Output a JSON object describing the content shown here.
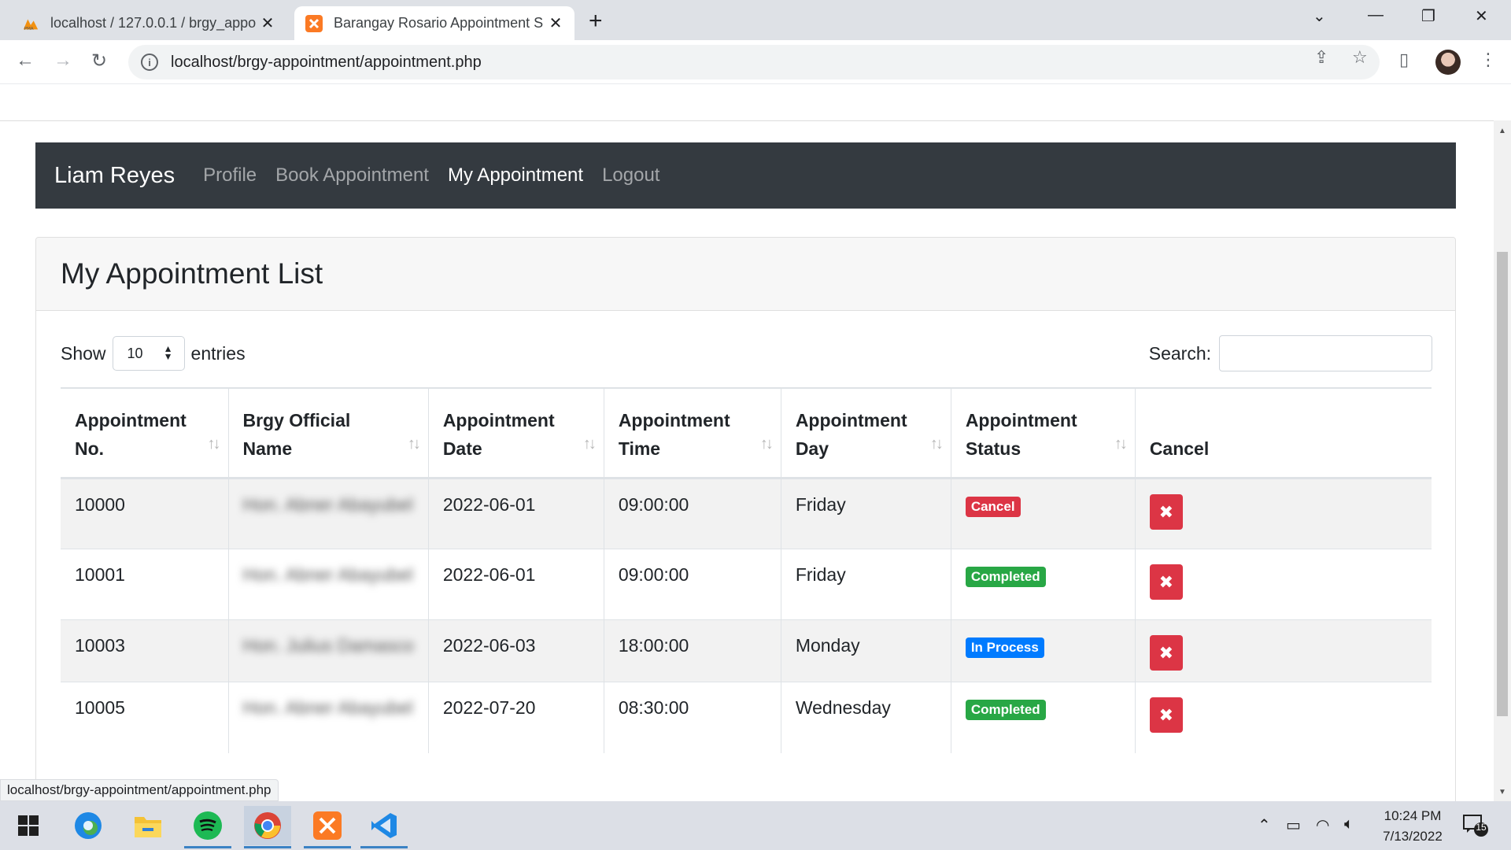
{
  "browser": {
    "tabs": [
      {
        "title": "localhost / 127.0.0.1 / brgy_appo",
        "favicon": "phpmyadmin-icon"
      },
      {
        "title": "Barangay Rosario Appointment S",
        "favicon": "xampp-icon"
      }
    ],
    "url": "localhost/brgy-appointment/appointment.php",
    "status_url": "localhost/brgy-appointment/appointment.php"
  },
  "navbar": {
    "brand": "Liam Reyes",
    "links": [
      "Profile",
      "Book Appointment",
      "My Appointment",
      "Logout"
    ],
    "active": "My Appointment"
  },
  "card": {
    "title": "My Appointment List",
    "show_label": "Show",
    "entries_value": "10",
    "entries_label": "entries",
    "search_label": "Search:"
  },
  "table": {
    "headers": [
      [
        "Appointment",
        "No."
      ],
      [
        "Brgy Official",
        "Name"
      ],
      [
        "Appointment",
        "Date"
      ],
      [
        "Appointment",
        "Time"
      ],
      [
        "Appointment",
        "Day"
      ],
      [
        "Appointment",
        "Status"
      ],
      [
        "Cancel"
      ]
    ],
    "rows": [
      {
        "no": "10000",
        "official": "Hon. Abner Abayubel",
        "date": "2022-06-01",
        "time": "09:00:00",
        "day": "Friday",
        "status": "Cancel",
        "status_color": "#dc3545"
      },
      {
        "no": "10001",
        "official": "Hon. Abner Abayubel",
        "date": "2022-06-01",
        "time": "09:00:00",
        "day": "Friday",
        "status": "Completed",
        "status_color": "#28a745"
      },
      {
        "no": "10003",
        "official": "Hon. Julius Damasco",
        "date": "2022-06-03",
        "time": "18:00:00",
        "day": "Monday",
        "status": "In Process",
        "status_color": "#007bff"
      },
      {
        "no": "10005",
        "official": "Hon. Abner Abayubel",
        "date": "2022-07-20",
        "time": "08:30:00",
        "day": "Wednesday",
        "status": "Completed",
        "status_color": "#28a745"
      }
    ]
  },
  "taskbar": {
    "time": "10:24 PM",
    "date": "7/13/2022",
    "notifications": "15"
  }
}
